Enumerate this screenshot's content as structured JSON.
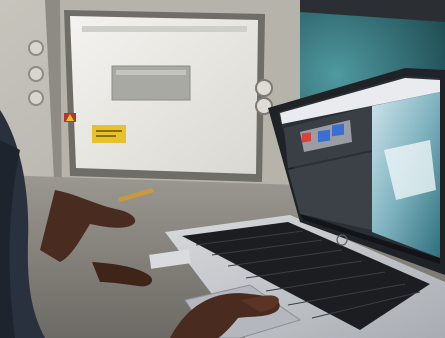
{
  "scene": {
    "palette": {
      "panel_housing": "#bdbab2",
      "panel_shadow": "#8e8b84",
      "panel_screen": "#ecebe6",
      "panel_bezel": "#6f6d68",
      "warning_yellow": "#e7c22a",
      "warning_red": "#b8342f",
      "laptop_silver": "#c9ccd0",
      "keyboard_black": "#1b1d21",
      "laptop_screen_dark": "#262a30",
      "video_teal": "#3e8e93",
      "hand_skin": "#4a2b1f",
      "sleeve_dark": "#28313d",
      "pencil": "#c99a3c"
    },
    "icons": {
      "brand_logo": "hp-logo-icon",
      "warning_sign": "warning-triangle-icon",
      "control_buttons": "round-button-icon"
    },
    "laptop_screen": {
      "toolbar_icon": "red-square-icon",
      "action_icon": "blue-square-icon"
    }
  }
}
